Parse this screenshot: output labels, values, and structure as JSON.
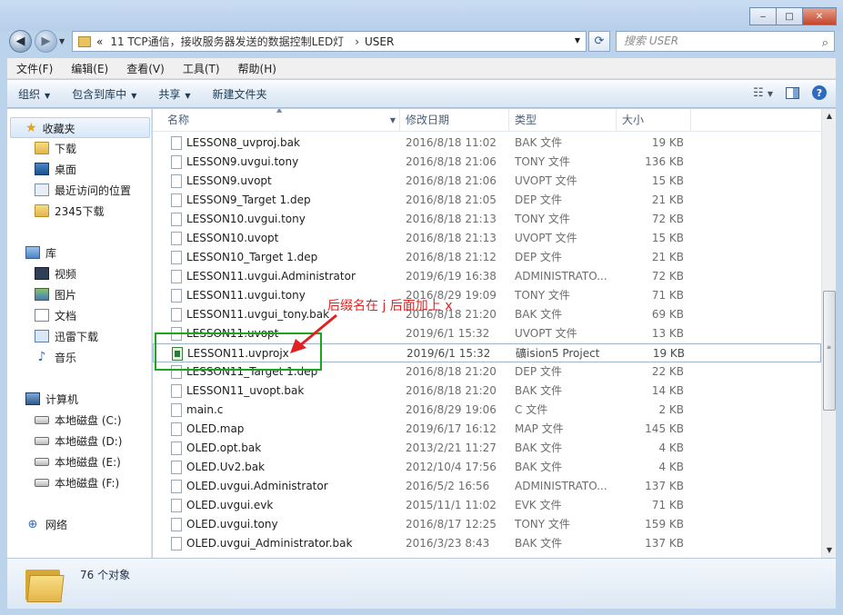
{
  "window": {
    "min": "‒",
    "max": "□",
    "close": "✕"
  },
  "address": {
    "prefix": "«",
    "folder": "11 TCP通信，接收服务器发送的数据控制LED灯",
    "sep": "›",
    "current": "USER"
  },
  "search": {
    "placeholder": "搜索 USER"
  },
  "menu": [
    "文件(F)",
    "编辑(E)",
    "查看(V)",
    "工具(T)",
    "帮助(H)"
  ],
  "toolbar": [
    "组织",
    "包含到库中",
    "共享",
    "新建文件夹"
  ],
  "nav": {
    "favorites": {
      "title": "收藏夹",
      "items": [
        "下载",
        "桌面",
        "最近访问的位置",
        "2345下载"
      ]
    },
    "libraries": {
      "title": "库",
      "items": [
        "视频",
        "图片",
        "文档",
        "迅雷下载",
        "音乐"
      ]
    },
    "computer": {
      "title": "计算机",
      "items": [
        "本地磁盘 (C:)",
        "本地磁盘 (D:)",
        "本地磁盘 (E:)",
        "本地磁盘 (F:)"
      ]
    },
    "network": {
      "title": "网络"
    }
  },
  "columns": {
    "name": "名称",
    "date": "修改日期",
    "type": "类型",
    "size": "大小"
  },
  "files": [
    {
      "name": "LESSON8_uvproj.bak",
      "date": "2016/8/18 11:02",
      "type": "BAK 文件",
      "size": "19 KB"
    },
    {
      "name": "LESSON9.uvgui.tony",
      "date": "2016/8/18 21:06",
      "type": "TONY 文件",
      "size": "136 KB"
    },
    {
      "name": "LESSON9.uvopt",
      "date": "2016/8/18 21:06",
      "type": "UVOPT 文件",
      "size": "15 KB"
    },
    {
      "name": "LESSON9_Target 1.dep",
      "date": "2016/8/18 21:05",
      "type": "DEP 文件",
      "size": "21 KB"
    },
    {
      "name": "LESSON10.uvgui.tony",
      "date": "2016/8/18 21:13",
      "type": "TONY 文件",
      "size": "72 KB"
    },
    {
      "name": "LESSON10.uvopt",
      "date": "2016/8/18 21:13",
      "type": "UVOPT 文件",
      "size": "15 KB"
    },
    {
      "name": "LESSON10_Target 1.dep",
      "date": "2016/8/18 21:12",
      "type": "DEP 文件",
      "size": "21 KB"
    },
    {
      "name": "LESSON11.uvgui.Administrator",
      "date": "2019/6/19 16:38",
      "type": "ADMINISTRATO...",
      "size": "72 KB"
    },
    {
      "name": "LESSON11.uvgui.tony",
      "date": "2016/8/29 19:09",
      "type": "TONY 文件",
      "size": "71 KB"
    },
    {
      "name": "LESSON11.uvgui_tony.bak",
      "date": "2016/8/18 21:20",
      "type": "BAK 文件",
      "size": "69 KB"
    },
    {
      "name": "LESSON11.uvopt",
      "date": "2019/6/1 15:32",
      "type": "UVOPT 文件",
      "size": "13 KB"
    },
    {
      "name": "LESSON11.uvprojx",
      "date": "2019/6/1 15:32",
      "type": "礦ision5 Project",
      "size": "19 KB",
      "selected": true
    },
    {
      "name": "LESSON11_Target 1.dep",
      "date": "2016/8/18 21:20",
      "type": "DEP 文件",
      "size": "22 KB"
    },
    {
      "name": "LESSON11_uvopt.bak",
      "date": "2016/8/18 21:20",
      "type": "BAK 文件",
      "size": "14 KB"
    },
    {
      "name": "main.c",
      "date": "2016/8/29 19:06",
      "type": "C 文件",
      "size": "2 KB"
    },
    {
      "name": "OLED.map",
      "date": "2019/6/17 16:12",
      "type": "MAP 文件",
      "size": "145 KB"
    },
    {
      "name": "OLED.opt.bak",
      "date": "2013/2/21 11:27",
      "type": "BAK 文件",
      "size": "4 KB"
    },
    {
      "name": "OLED.Uv2.bak",
      "date": "2012/10/4 17:56",
      "type": "BAK 文件",
      "size": "4 KB"
    },
    {
      "name": "OLED.uvgui.Administrator",
      "date": "2016/5/2 16:56",
      "type": "ADMINISTRATO...",
      "size": "137 KB"
    },
    {
      "name": "OLED.uvgui.evk",
      "date": "2015/11/1 11:02",
      "type": "EVK 文件",
      "size": "71 KB"
    },
    {
      "name": "OLED.uvgui.tony",
      "date": "2016/8/17 12:25",
      "type": "TONY 文件",
      "size": "159 KB"
    },
    {
      "name": "OLED.uvgui_Administrator.bak",
      "date": "2016/3/23 8:43",
      "type": "BAK 文件",
      "size": "137 KB"
    }
  ],
  "annotation": {
    "text": "后缀名在 j 后面加上 x",
    "box_color": "#1ea51e",
    "text_color": "#e22222"
  },
  "status": {
    "count": "76 个对象"
  }
}
